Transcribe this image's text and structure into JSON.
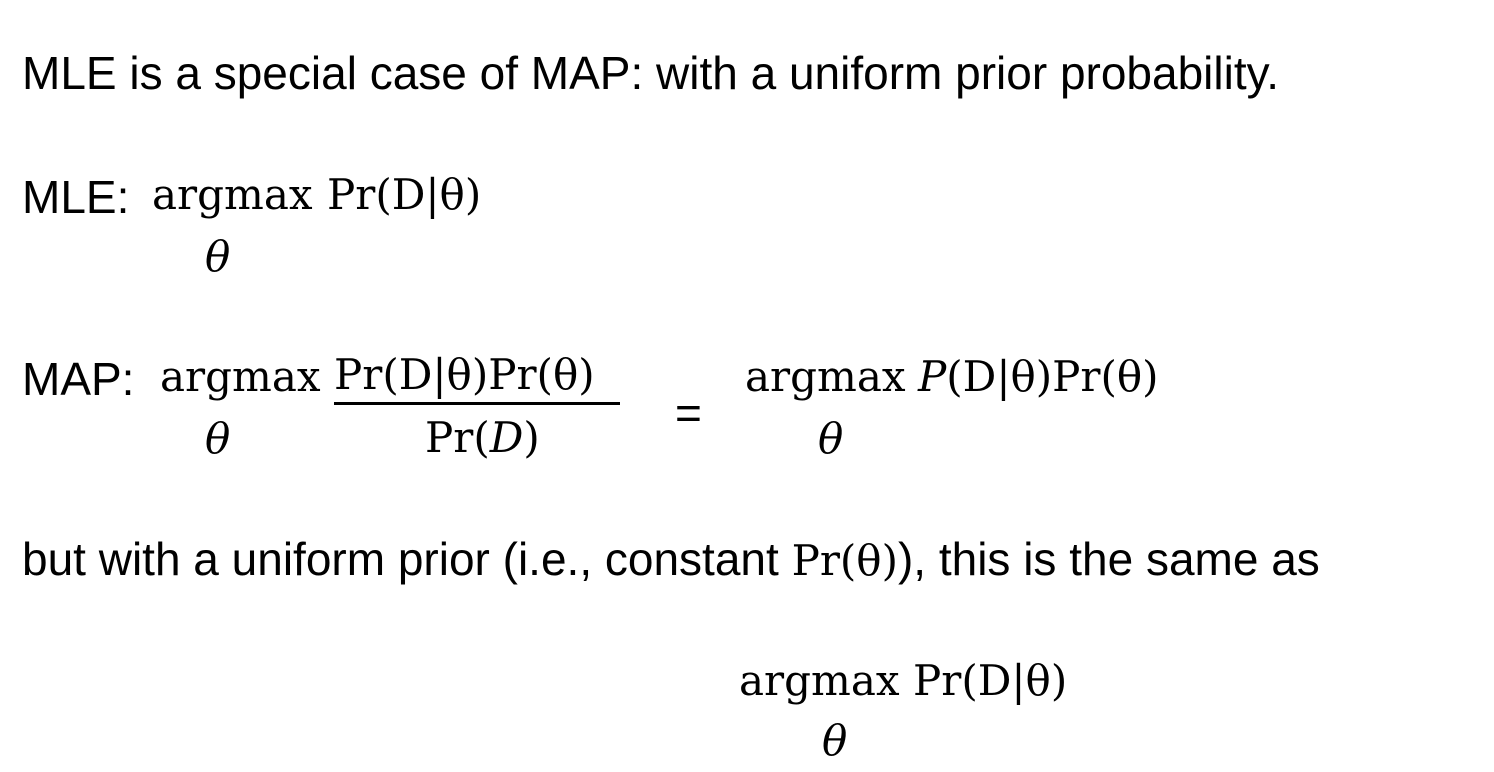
{
  "heading": "MLE is a  special case of MAP: with a uniform prior probability.",
  "mle": {
    "label": "MLE:",
    "operator": "argmax",
    "expression": "Pr(D|θ)",
    "subscript": "θ"
  },
  "map": {
    "label": "MAP:",
    "operator": "argmax",
    "numerator": "Pr(D|θ)Pr(θ)",
    "denominator_prefix": "Pr(",
    "denominator_var": "D",
    "denominator_suffix": ")",
    "subscript": "θ",
    "equals": "=",
    "rhs_operator": "argmax",
    "rhs_expression_italic": "P",
    "rhs_expression": "(D|θ)Pr(θ)",
    "rhs_subscript": "θ"
  },
  "uniform_text": {
    "before": "but with a uniform prior (i.e., constant ",
    "math": "Pr(θ)",
    "after": "), this is the same as"
  },
  "result": {
    "operator": "argmax",
    "expression": "Pr(D|θ)",
    "subscript": "θ"
  }
}
